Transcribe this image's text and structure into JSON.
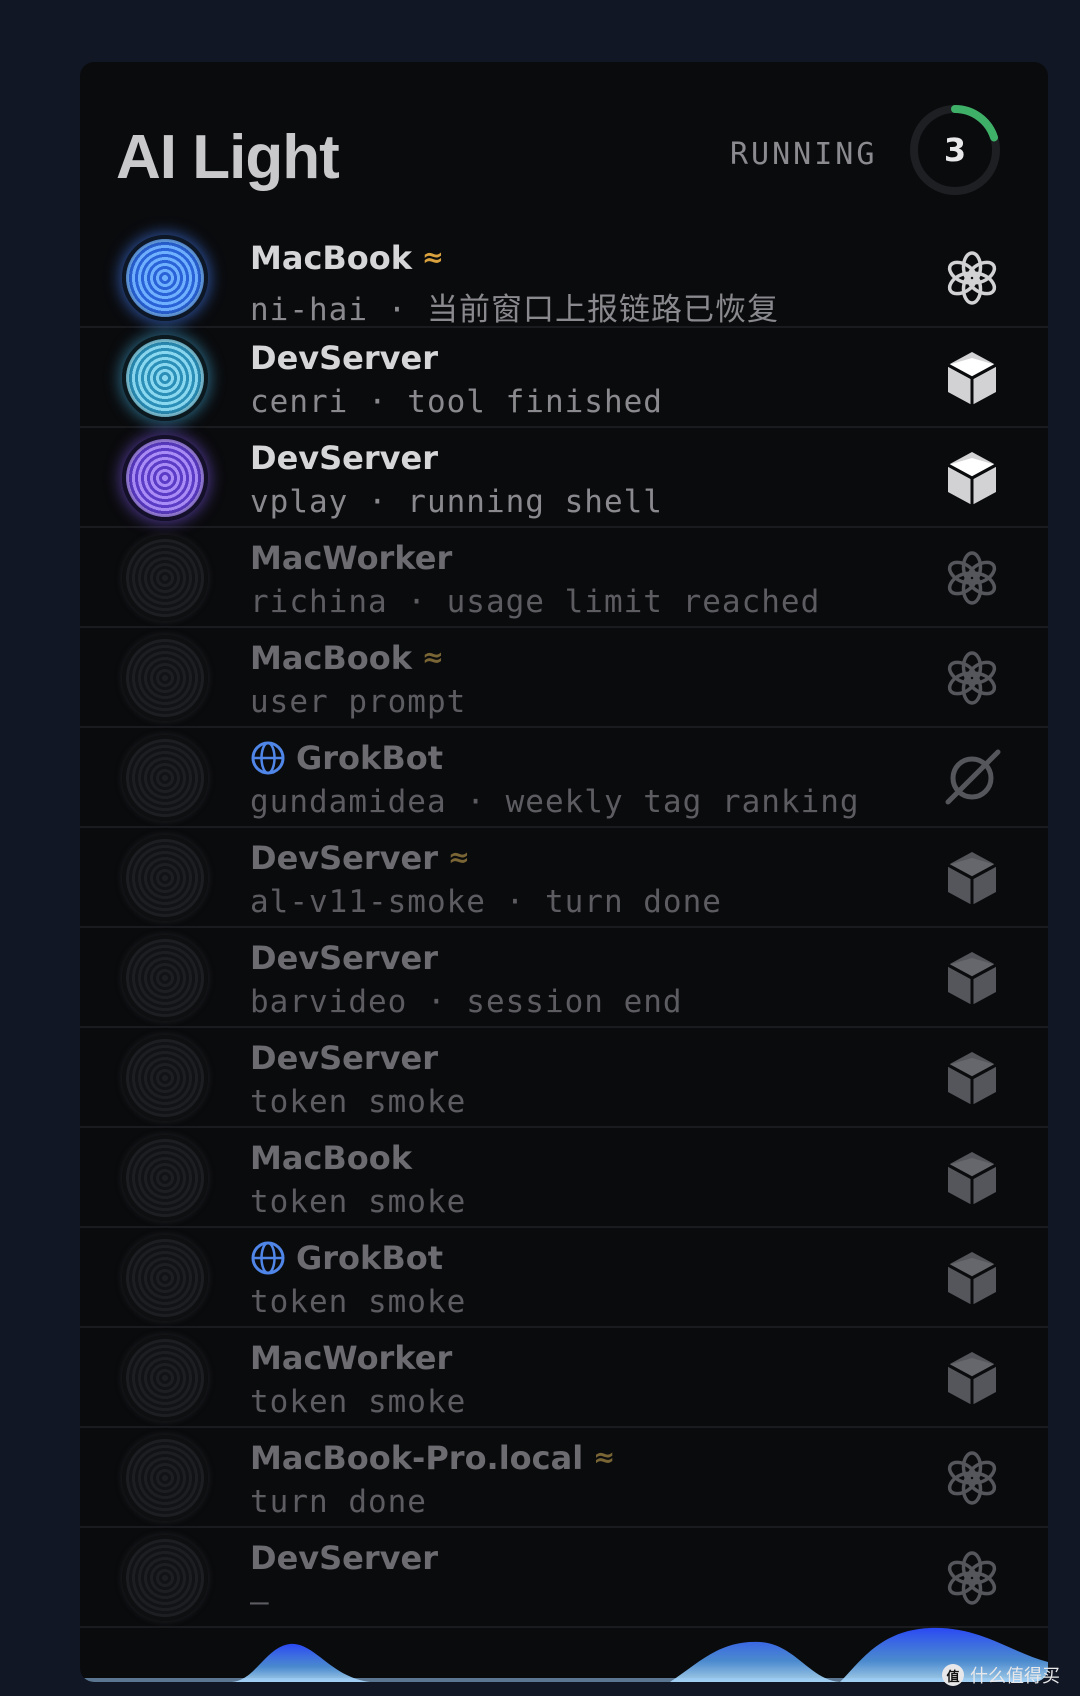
{
  "header": {
    "title": "AI Light",
    "status_label": "RUNNING",
    "running_count": "3",
    "ring_progress": 0.2
  },
  "colors": {
    "ring_progress": "#3fb068",
    "wave_symbol": "#d9a23e",
    "globe": "#4f86e8"
  },
  "sessions": [
    {
      "device": "MacBook",
      "wave": "≈",
      "globe": false,
      "detail": "ni-hai · 当前窗口上报链路已恢复",
      "orb": "blue",
      "agent_icon": "openai-icon",
      "active": true
    },
    {
      "device": "DevServer",
      "wave": "",
      "globe": false,
      "detail": "cenri · tool finished",
      "orb": "cyan",
      "agent_icon": "cube-icon",
      "active": true
    },
    {
      "device": "DevServer",
      "wave": "",
      "globe": false,
      "detail": "vplay · running shell",
      "orb": "purple",
      "agent_icon": "cube-icon",
      "active": true
    },
    {
      "device": "MacWorker",
      "wave": "",
      "globe": false,
      "detail": "richina · usage limit reached",
      "orb": "off",
      "agent_icon": "openai-icon",
      "active": false
    },
    {
      "device": "MacBook",
      "wave": "≈",
      "globe": false,
      "detail": "user prompt",
      "orb": "off",
      "agent_icon": "openai-icon",
      "active": false
    },
    {
      "device": "GrokBot",
      "wave": "",
      "globe": true,
      "detail": "gundamidea · weekly tag ranking",
      "orb": "off",
      "agent_icon": "grok-icon",
      "active": false
    },
    {
      "device": "DevServer",
      "wave": "≈",
      "globe": false,
      "detail": "al-v11-smoke · turn done",
      "orb": "off",
      "agent_icon": "cube-icon",
      "active": false
    },
    {
      "device": "DevServer",
      "wave": "",
      "globe": false,
      "detail": "barvideo · session end",
      "orb": "off",
      "agent_icon": "cube-icon",
      "active": false
    },
    {
      "device": "DevServer",
      "wave": "",
      "globe": false,
      "detail": "token smoke",
      "orb": "off",
      "agent_icon": "cube-icon",
      "active": false
    },
    {
      "device": "MacBook",
      "wave": "",
      "globe": false,
      "detail": "token smoke",
      "orb": "off",
      "agent_icon": "cube-icon",
      "active": false
    },
    {
      "device": "GrokBot",
      "wave": "",
      "globe": true,
      "detail": "token smoke",
      "orb": "off",
      "agent_icon": "cube-icon",
      "active": false
    },
    {
      "device": "MacWorker",
      "wave": "",
      "globe": false,
      "detail": "token smoke",
      "orb": "off",
      "agent_icon": "cube-icon",
      "active": false
    },
    {
      "device": "MacBook-Pro.local",
      "wave": "≈",
      "globe": false,
      "detail": "turn done",
      "orb": "off",
      "agent_icon": "openai-icon",
      "active": false
    },
    {
      "device": "DevServer",
      "wave": "",
      "globe": false,
      "detail": "—",
      "orb": "off",
      "agent_icon": "openai-icon",
      "active": false
    }
  ],
  "watermark": {
    "badge": "值",
    "text": "什么值得买"
  }
}
